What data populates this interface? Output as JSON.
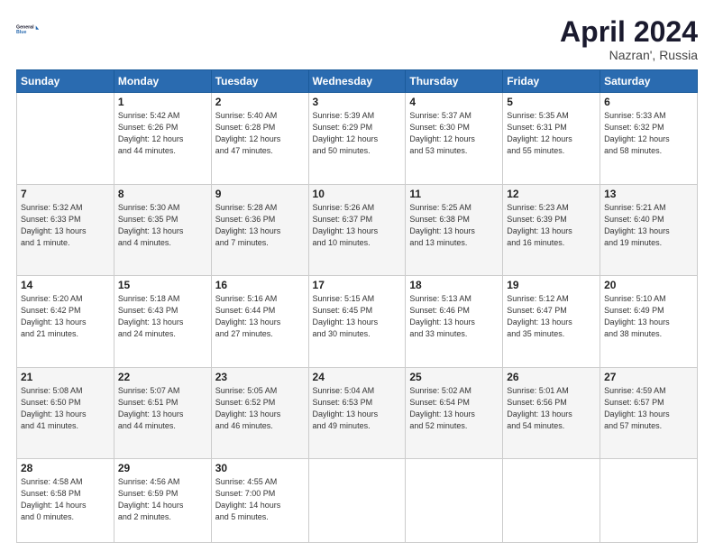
{
  "header": {
    "logo_line1": "General",
    "logo_line2": "Blue",
    "month": "April 2024",
    "location": "Nazran', Russia"
  },
  "weekdays": [
    "Sunday",
    "Monday",
    "Tuesday",
    "Wednesday",
    "Thursday",
    "Friday",
    "Saturday"
  ],
  "weeks": [
    [
      {
        "day": "",
        "info": ""
      },
      {
        "day": "1",
        "info": "Sunrise: 5:42 AM\nSunset: 6:26 PM\nDaylight: 12 hours\nand 44 minutes."
      },
      {
        "day": "2",
        "info": "Sunrise: 5:40 AM\nSunset: 6:28 PM\nDaylight: 12 hours\nand 47 minutes."
      },
      {
        "day": "3",
        "info": "Sunrise: 5:39 AM\nSunset: 6:29 PM\nDaylight: 12 hours\nand 50 minutes."
      },
      {
        "day": "4",
        "info": "Sunrise: 5:37 AM\nSunset: 6:30 PM\nDaylight: 12 hours\nand 53 minutes."
      },
      {
        "day": "5",
        "info": "Sunrise: 5:35 AM\nSunset: 6:31 PM\nDaylight: 12 hours\nand 55 minutes."
      },
      {
        "day": "6",
        "info": "Sunrise: 5:33 AM\nSunset: 6:32 PM\nDaylight: 12 hours\nand 58 minutes."
      }
    ],
    [
      {
        "day": "7",
        "info": "Sunrise: 5:32 AM\nSunset: 6:33 PM\nDaylight: 13 hours\nand 1 minute."
      },
      {
        "day": "8",
        "info": "Sunrise: 5:30 AM\nSunset: 6:35 PM\nDaylight: 13 hours\nand 4 minutes."
      },
      {
        "day": "9",
        "info": "Sunrise: 5:28 AM\nSunset: 6:36 PM\nDaylight: 13 hours\nand 7 minutes."
      },
      {
        "day": "10",
        "info": "Sunrise: 5:26 AM\nSunset: 6:37 PM\nDaylight: 13 hours\nand 10 minutes."
      },
      {
        "day": "11",
        "info": "Sunrise: 5:25 AM\nSunset: 6:38 PM\nDaylight: 13 hours\nand 13 minutes."
      },
      {
        "day": "12",
        "info": "Sunrise: 5:23 AM\nSunset: 6:39 PM\nDaylight: 13 hours\nand 16 minutes."
      },
      {
        "day": "13",
        "info": "Sunrise: 5:21 AM\nSunset: 6:40 PM\nDaylight: 13 hours\nand 19 minutes."
      }
    ],
    [
      {
        "day": "14",
        "info": "Sunrise: 5:20 AM\nSunset: 6:42 PM\nDaylight: 13 hours\nand 21 minutes."
      },
      {
        "day": "15",
        "info": "Sunrise: 5:18 AM\nSunset: 6:43 PM\nDaylight: 13 hours\nand 24 minutes."
      },
      {
        "day": "16",
        "info": "Sunrise: 5:16 AM\nSunset: 6:44 PM\nDaylight: 13 hours\nand 27 minutes."
      },
      {
        "day": "17",
        "info": "Sunrise: 5:15 AM\nSunset: 6:45 PM\nDaylight: 13 hours\nand 30 minutes."
      },
      {
        "day": "18",
        "info": "Sunrise: 5:13 AM\nSunset: 6:46 PM\nDaylight: 13 hours\nand 33 minutes."
      },
      {
        "day": "19",
        "info": "Sunrise: 5:12 AM\nSunset: 6:47 PM\nDaylight: 13 hours\nand 35 minutes."
      },
      {
        "day": "20",
        "info": "Sunrise: 5:10 AM\nSunset: 6:49 PM\nDaylight: 13 hours\nand 38 minutes."
      }
    ],
    [
      {
        "day": "21",
        "info": "Sunrise: 5:08 AM\nSunset: 6:50 PM\nDaylight: 13 hours\nand 41 minutes."
      },
      {
        "day": "22",
        "info": "Sunrise: 5:07 AM\nSunset: 6:51 PM\nDaylight: 13 hours\nand 44 minutes."
      },
      {
        "day": "23",
        "info": "Sunrise: 5:05 AM\nSunset: 6:52 PM\nDaylight: 13 hours\nand 46 minutes."
      },
      {
        "day": "24",
        "info": "Sunrise: 5:04 AM\nSunset: 6:53 PM\nDaylight: 13 hours\nand 49 minutes."
      },
      {
        "day": "25",
        "info": "Sunrise: 5:02 AM\nSunset: 6:54 PM\nDaylight: 13 hours\nand 52 minutes."
      },
      {
        "day": "26",
        "info": "Sunrise: 5:01 AM\nSunset: 6:56 PM\nDaylight: 13 hours\nand 54 minutes."
      },
      {
        "day": "27",
        "info": "Sunrise: 4:59 AM\nSunset: 6:57 PM\nDaylight: 13 hours\nand 57 minutes."
      }
    ],
    [
      {
        "day": "28",
        "info": "Sunrise: 4:58 AM\nSunset: 6:58 PM\nDaylight: 14 hours\nand 0 minutes."
      },
      {
        "day": "29",
        "info": "Sunrise: 4:56 AM\nSunset: 6:59 PM\nDaylight: 14 hours\nand 2 minutes."
      },
      {
        "day": "30",
        "info": "Sunrise: 4:55 AM\nSunset: 7:00 PM\nDaylight: 14 hours\nand 5 minutes."
      },
      {
        "day": "",
        "info": ""
      },
      {
        "day": "",
        "info": ""
      },
      {
        "day": "",
        "info": ""
      },
      {
        "day": "",
        "info": ""
      }
    ]
  ]
}
